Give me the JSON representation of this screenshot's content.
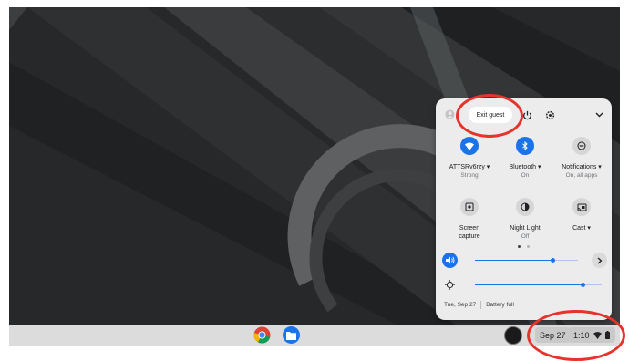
{
  "colors": {
    "accent": "#1a73e8",
    "annotation": "#e8322c",
    "wallpaper": "#222426"
  },
  "quick_settings": {
    "exit_guest_label": "Exit guest",
    "features_row1": [
      {
        "icon": "wifi-icon",
        "label": "ATTSRv6rzy ▾",
        "sub": "Strong",
        "active": true
      },
      {
        "icon": "bluetooth-icon",
        "label": "Bluetooth ▾",
        "sub": "On",
        "active": true
      },
      {
        "icon": "notifications-icon",
        "label": "Notifications ▾",
        "sub": "On, all apps",
        "active": false
      }
    ],
    "features_row2": [
      {
        "icon": "screen-capture-icon",
        "label": "Screen capture",
        "sub": "",
        "active": false
      },
      {
        "icon": "night-light-icon",
        "label": "Night Light",
        "sub": "Off",
        "active": false
      },
      {
        "icon": "cast-icon",
        "label": "Cast ▾",
        "sub": "",
        "active": false
      }
    ],
    "volume_level": 0.75,
    "brightness_level": 0.85,
    "footer_date": "Tue, Sep 27",
    "footer_battery": "Battery full"
  },
  "shelf": {
    "date": "Sep 27",
    "time": "1:10",
    "apps": [
      "chrome-icon",
      "files-icon"
    ]
  }
}
